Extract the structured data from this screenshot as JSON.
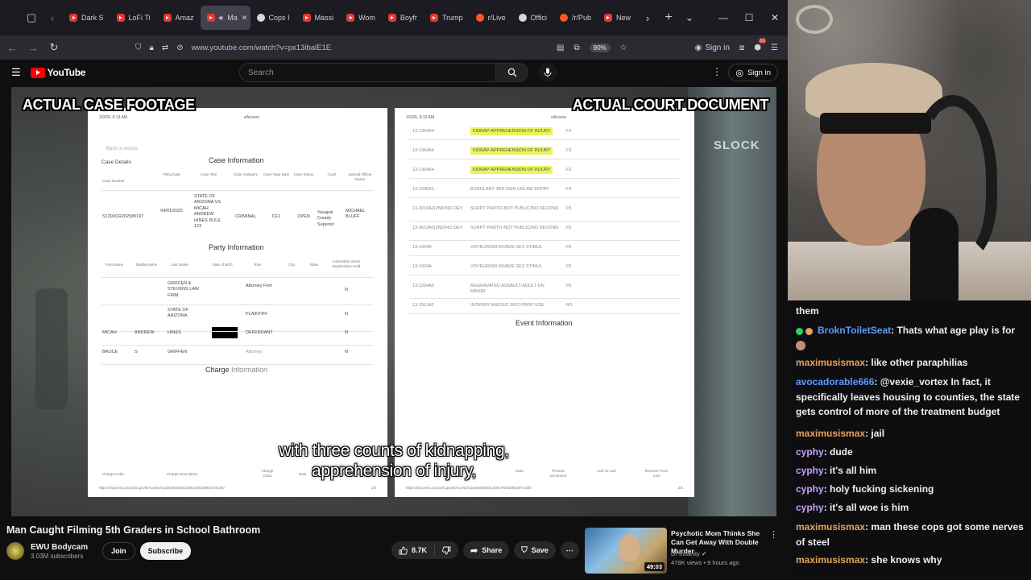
{
  "browser": {
    "tabs": [
      {
        "label": "Dark S",
        "type": "yt"
      },
      {
        "label": "LoFi Ti",
        "type": "yt"
      },
      {
        "label": "Amaz",
        "type": "yt"
      },
      {
        "label": "Ma",
        "type": "yt"
      },
      {
        "label": "Cops I",
        "type": "round"
      },
      {
        "label": "Massi",
        "type": "yt"
      },
      {
        "label": "Wom",
        "type": "yt"
      },
      {
        "label": "Boyfr",
        "type": "yt"
      },
      {
        "label": "Trump",
        "type": "yt"
      },
      {
        "label": "r/Live",
        "type": "reddit"
      },
      {
        "label": "Offici",
        "type": "round"
      },
      {
        "label": "/r/Pub",
        "type": "reddit"
      },
      {
        "label": "New",
        "type": "yt"
      }
    ],
    "url": "www.youtube.com/watch?v=px13ibalE1E",
    "zoom": "90%",
    "signin_label": "Sign in",
    "ext_badge": "85"
  },
  "youtube": {
    "logo_text": "YouTube",
    "search_placeholder": "Search",
    "signin_label": "Sign in"
  },
  "video": {
    "label_left": "ACTUAL CASE FOOTAGE",
    "label_right": "ACTUAL COURT DOCUMENT",
    "subtitle_line1": "with three counts of kidnapping,",
    "subtitle_line2": "apprehension of injury,",
    "doc_left": {
      "header_date": "1/9/26, 8:13 AM",
      "header_site": "eAccess",
      "back_link": "Back to results",
      "case_details": "Case Details",
      "case_info_title": "Case Information",
      "case_cols": [
        "Case Number",
        "Filing Date",
        "Case Title",
        "Case Category",
        "Case Type Date",
        "Case Status",
        "Court",
        "Judicial Officer Name"
      ],
      "case_row": [
        "S1300CR202580197",
        "04/01/2025",
        "STATE OF ARIZONA VS MICAH ANDREW HINES RULE 123",
        "CRIMINAL",
        "CF1",
        "OPEN",
        "Yavapai County Superior",
        "MICHAEL BLUFF"
      ],
      "party_info_title": "Party Information",
      "party_cols": [
        "First Name",
        "Middle Name",
        "Last Name",
        "Date of Birth",
        "Role",
        "City",
        "State",
        "Vulnerable Victim Registration Hold"
      ],
      "parties": [
        {
          "first": "",
          "middle": "",
          "last": "GRIFFEN & STEVENS LAW FIRM",
          "role": "Attorney Firm",
          "hold": "N"
        },
        {
          "first": "",
          "middle": "",
          "last": "STATE OF ARIZONA",
          "role": "PLAINTIFF",
          "hold": "N"
        },
        {
          "first": "MICAH",
          "middle": "ANDREW",
          "last": "HINES",
          "role": "DEFENDANT",
          "hold": "N"
        },
        {
          "first": "BRUCE",
          "middle": "S",
          "last": "GRIFFEN",
          "role": "Attorney",
          "hold": "N"
        }
      ],
      "charge_info_title_a": "Charge ",
      "charge_info_title_b": "Information",
      "footer_cols": [
        "Charge Code",
        "Charge Description",
        "Charge Class",
        "Data",
        "Preview Document",
        "Add To Cart",
        "Remove From Cart"
      ],
      "footer_url": "https://eaccess.azcourts.gov/EAccess/CaseDetails/S1300CR202580197/1300",
      "page_num": "1/5"
    },
    "doc_right": {
      "header_date": "1/9/26, 8:13 AM",
      "header_site": "eAccess",
      "charges": [
        {
          "code": "13-1304A4",
          "desc": "KIDNAP-APPREHENSION OF INJURY",
          "class": "F3",
          "highlight": true
        },
        {
          "code": "13-1304A4",
          "desc": "KIDNAP-APPREHENSION OF INJURY",
          "class": "F3",
          "highlight": true
        },
        {
          "code": "13-1304A4",
          "desc": "KIDNAP-APPREHENSION OF INJURY",
          "class": "F3",
          "highlight": true
        },
        {
          "code": "13-1506A1",
          "desc": "BURGLARY 3RD DGR-UNLAW ENTRY",
          "class": "F4",
          "highlight": false
        },
        {
          "code": "13-3019A2(2ND/NO DEV",
          "desc": "SURPT PHOTO-NOT PUBLIC/NO DEV/2ND",
          "class": "F5",
          "highlight": false
        },
        {
          "code": "13-3019A2(2ND/NO DEV",
          "desc": "SURPT PHOTO-NOT PUBLIC/NO DEV/2ND",
          "class": "F5",
          "highlight": false
        },
        {
          "code": "13-1424A",
          "desc": "VOYEURISM-INVADE SEX STIMUL",
          "class": "F5",
          "highlight": false
        },
        {
          "code": "13-1424A",
          "desc": "VOYEURISM-INVADE SEX STIMUL",
          "class": "F5",
          "highlight": false
        },
        {
          "code": "13-1204A6",
          "desc": "AGGRAVATED ASSAULT-ADULT ON MINOR",
          "class": "F6",
          "highlight": false
        },
        {
          "code": "13-2911A2",
          "desc": "INTERFR W/EDUC INST PROP USE",
          "class": "M1",
          "highlight": false
        }
      ],
      "event_info_title": "Event Information",
      "footer_url": "https://eaccess.azcourts.gov/EAccess/CaseDetails/S1300CR202580197/1300",
      "page_num": "2/5",
      "watermark": "SLOCK"
    }
  },
  "below": {
    "title": "Man Caught Filming 5th Graders in School Bathroom",
    "channel": "EWU Bodycam",
    "subscribers": "3.03M subscribers",
    "join": "Join",
    "subscribe": "Subscribe",
    "likes": "8.7K",
    "share": "Share",
    "save": "Save"
  },
  "recommended": {
    "title": "Psychotic Mom Thinks She Can Get Away With Double Murder",
    "channel": "Dr Insanity",
    "meta": "478K views • 9 hours ago",
    "duration": "49:03"
  },
  "chat": [
    {
      "user": "",
      "msg": "them",
      "color": "#efeff1"
    },
    {
      "user": "BroknToiletSeat",
      "msg": ": Thats what age play is for",
      "color": "#5b9bff",
      "badges": true
    },
    {
      "user": "maximusismax",
      "msg": ": like other paraphilias",
      "color": "#e8a25a"
    },
    {
      "user": "avocadorable666",
      "msg": ": @vexie_vortex In fact, it specifically leaves housing to counties, the state gets control of more of the treatment budget",
      "color": "#5b9bff"
    },
    {
      "user": "maximusismax",
      "msg": ": jail",
      "color": "#e8a25a"
    },
    {
      "user": "cyphy",
      "msg": ": dude",
      "color": "#c5a0ff"
    },
    {
      "user": "cyphy",
      "msg": ": it's all him",
      "color": "#c5a0ff"
    },
    {
      "user": "cyphy",
      "msg": ": holy fucking sickening",
      "color": "#c5a0ff"
    },
    {
      "user": "cyphy",
      "msg": ": it's all woe is him",
      "color": "#c5a0ff"
    },
    {
      "user": "maximusismax",
      "msg": ": man these cops got some nerves of steel",
      "color": "#e8a25a"
    },
    {
      "user": "maximusismax",
      "msg": ": she knows why",
      "color": "#e8a25a"
    }
  ]
}
